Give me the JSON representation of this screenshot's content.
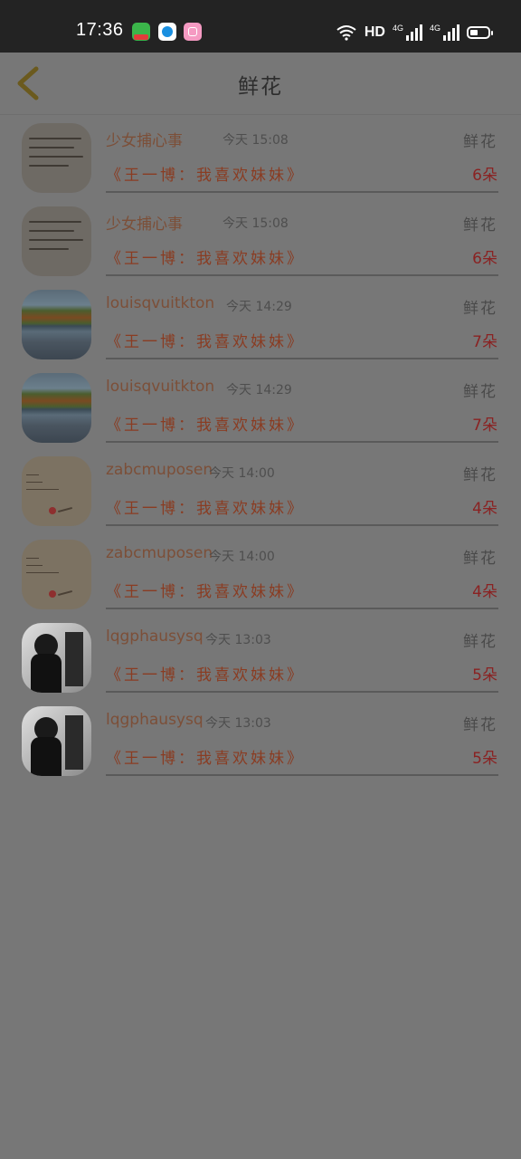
{
  "status_bar": {
    "time": "17:36",
    "network_label": "HD",
    "net1": "4G",
    "net2": "4G"
  },
  "header": {
    "title": "鲜花",
    "back_icon": "chevron-left-icon"
  },
  "records": [
    {
      "sender": "少女捕心事",
      "time": "今天 15:08",
      "category": "鲜花",
      "gift": "《王一博：我喜欢妹妹》",
      "count": "6朵",
      "avatar": "handwritten-note"
    },
    {
      "sender": "少女捕心事",
      "time": "今天 15:08",
      "category": "鲜花",
      "gift": "《王一博：我喜欢妹妹》",
      "count": "6朵",
      "avatar": "handwritten-note"
    },
    {
      "sender": "louisqvuitkton",
      "time": "今天 14:29",
      "category": "鲜花",
      "gift": "《王一博：我喜欢妹妹》",
      "count": "7朵",
      "avatar": "lake-landscape"
    },
    {
      "sender": "louisqvuitkton",
      "time": "今天 14:29",
      "category": "鲜花",
      "gift": "《王一博：我喜欢妹妹》",
      "count": "7朵",
      "avatar": "lake-landscape"
    },
    {
      "sender": "zabcmuposen",
      "time": "今天 14:00",
      "category": "鲜花",
      "gift": "《王一博：我喜欢妹妹》",
      "count": "4朵",
      "avatar": "text-card"
    },
    {
      "sender": "zabcmuposen",
      "time": "今天 14:00",
      "category": "鲜花",
      "gift": "《王一博：我喜欢妹妹》",
      "count": "4朵",
      "avatar": "text-card"
    },
    {
      "sender": "lqgphausysq",
      "time": "今天 13:03",
      "category": "鲜花",
      "gift": "《王一博：我喜欢妹妹》",
      "count": "5朵",
      "avatar": "bw-portrait"
    },
    {
      "sender": "lqgphausysq",
      "time": "今天 13:03",
      "category": "鲜花",
      "gift": "《王一博：我喜欢妹妹》",
      "count": "5朵",
      "avatar": "bw-portrait"
    }
  ],
  "colors": {
    "overlay": "#777777",
    "status_bar": "#232323",
    "name": "#7c4f38",
    "gift": "#8a3c22",
    "count": "#8a2222"
  }
}
